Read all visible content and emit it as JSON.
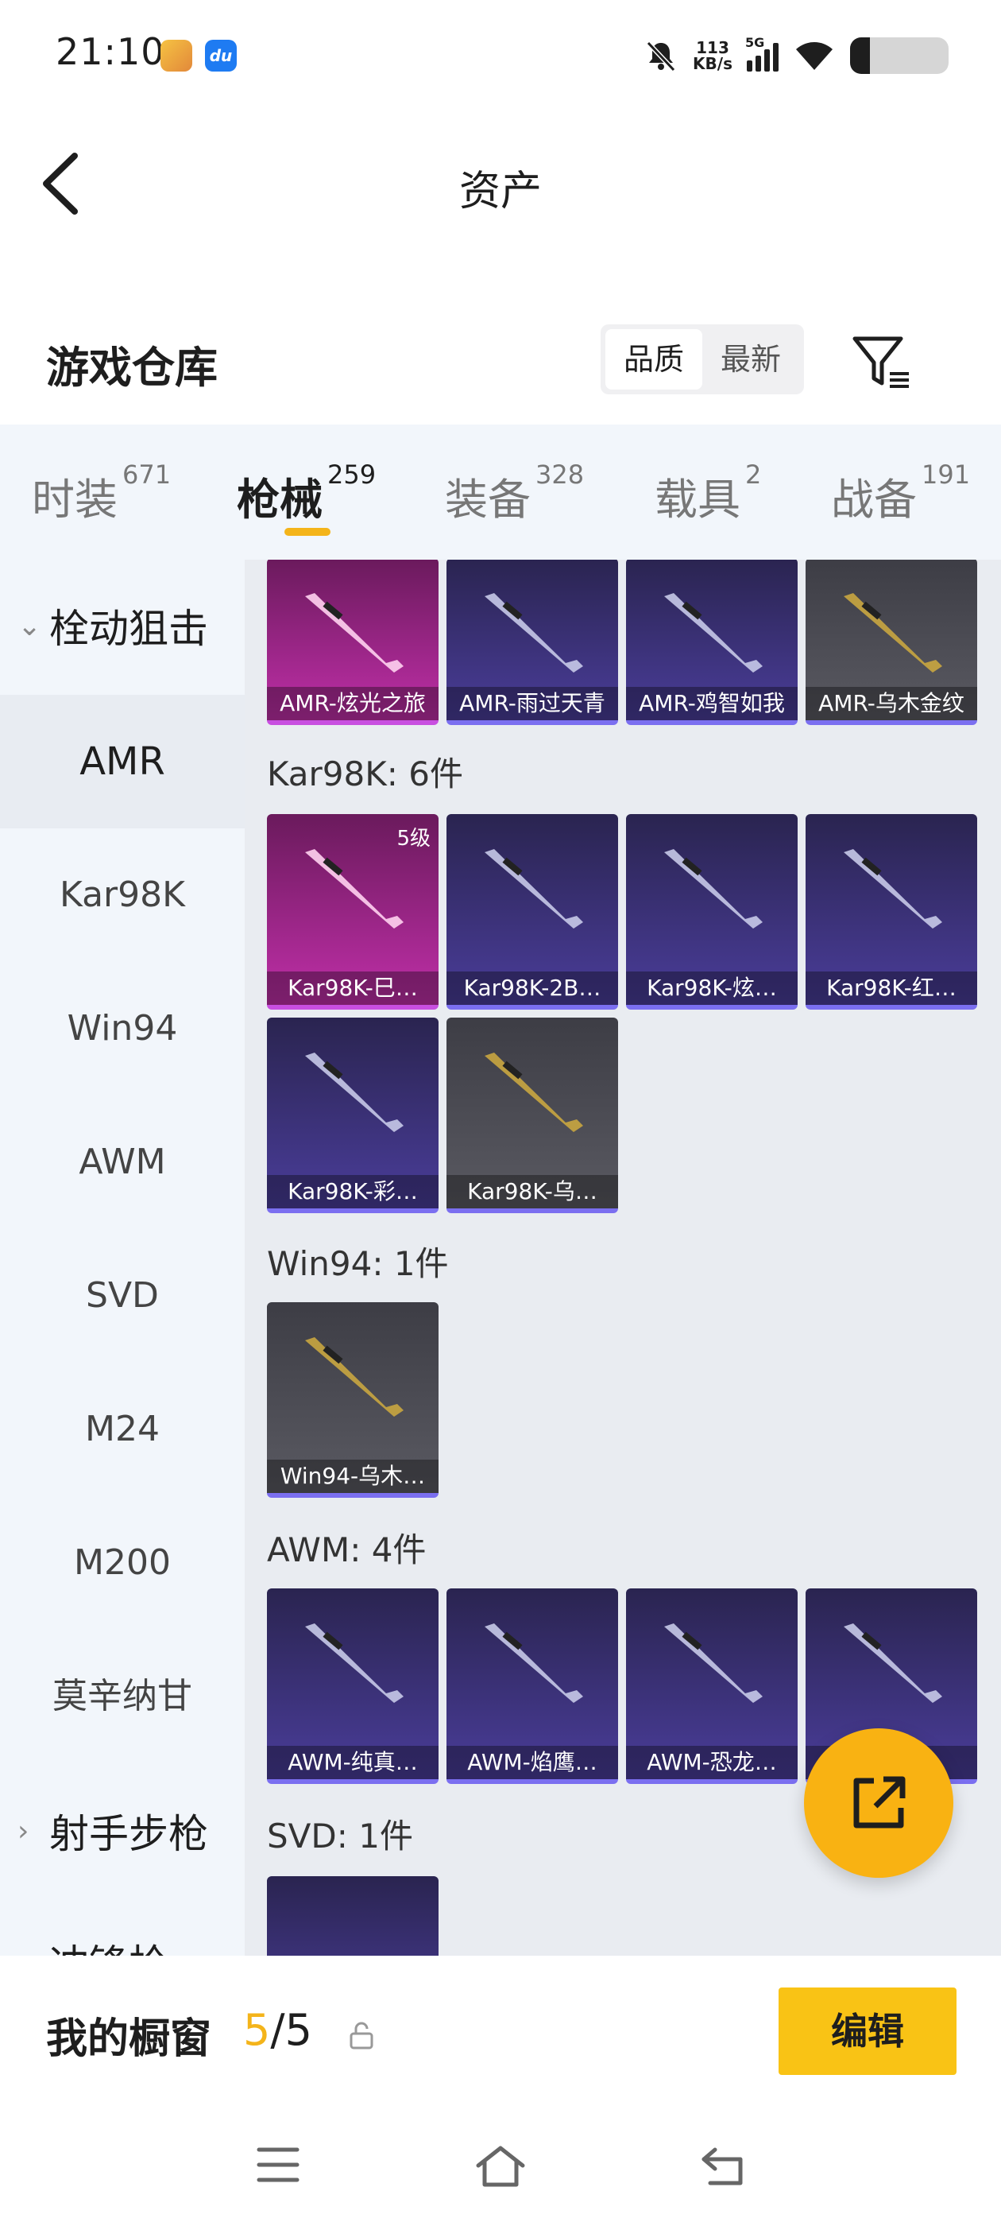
{
  "status": {
    "time": "21:10",
    "net_speed_value": "113",
    "net_speed_unit": "KB/s",
    "network": "5G",
    "battery_level": 0.2
  },
  "header": {
    "title": "资产"
  },
  "warehouse": {
    "title": "游戏仓库",
    "sort_options": [
      "品质",
      "最新"
    ],
    "sort_selected": "品质"
  },
  "tabs": [
    {
      "label": "时装",
      "count": "671"
    },
    {
      "label": "枪械",
      "count": "259"
    },
    {
      "label": "装备",
      "count": "328"
    },
    {
      "label": "载具",
      "count": "2"
    },
    {
      "label": "战备",
      "count": "191"
    }
  ],
  "sidebar": {
    "group1": "栓动狙击",
    "items": [
      "AMR",
      "Kar98K",
      "Win94",
      "AWM",
      "SVD",
      "M24",
      "M200",
      "莫辛纳甘"
    ],
    "group2": "射手步枪",
    "group3": "冲锋枪"
  },
  "groups": {
    "amr": {
      "items": [
        {
          "name": "AMR-炫光之旅",
          "color": "pink"
        },
        {
          "name": "AMR-雨过天青",
          "color": "purple"
        },
        {
          "name": "AMR-鸡智如我",
          "color": "purple"
        },
        {
          "name": "AMR-乌木金纹",
          "color": "gray"
        }
      ]
    },
    "kar98k": {
      "title": "Kar98K: 6件",
      "items": [
        {
          "name": "Kar98K-巳…",
          "level": "5级",
          "color": "pink"
        },
        {
          "name": "Kar98K-2B…",
          "color": "purple"
        },
        {
          "name": "Kar98K-炫…",
          "color": "purple"
        },
        {
          "name": "Kar98K-红…",
          "color": "purple"
        },
        {
          "name": "Kar98K-彩…",
          "color": "purple"
        },
        {
          "name": "Kar98K-乌…",
          "color": "gray"
        }
      ]
    },
    "win94": {
      "title": "Win94: 1件",
      "items": [
        {
          "name": "Win94-乌木…",
          "color": "gray"
        }
      ]
    },
    "awm": {
      "title": "AWM: 4件",
      "items": [
        {
          "name": "AWM-纯真…",
          "color": "purple"
        },
        {
          "name": "AWM-焰鹰…",
          "color": "purple"
        },
        {
          "name": "AWM-恐龙…",
          "color": "purple"
        },
        {
          "name": "…",
          "color": "purple"
        }
      ]
    },
    "svd": {
      "title": "SVD: 1件"
    }
  },
  "showcase": {
    "label": "我的橱窗",
    "current": "5",
    "separator": "/",
    "total": "5",
    "edit_label": "编辑"
  }
}
